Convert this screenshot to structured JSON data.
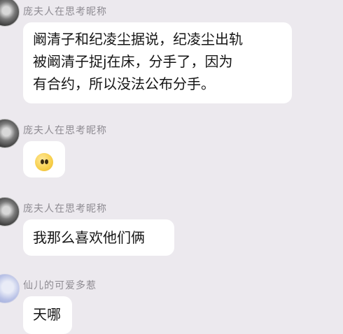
{
  "messages": [
    {
      "sender": "庞夫人在思考昵称",
      "avatar": "gray-avatar",
      "lines": [
        "阚清子和纪凌尘据说，纪凌尘出轨",
        "被阚清子捉j在床，分手了，因为",
        "有合约，所以没法公布分手。"
      ]
    },
    {
      "sender": "庞夫人在思考昵称",
      "avatar": "gray-avatar",
      "emoji": "yellow-face-emoji"
    },
    {
      "sender": "庞夫人在思考昵称",
      "avatar": "gray-avatar",
      "lines": [
        "我那么喜欢他们俩"
      ]
    },
    {
      "sender": "仙儿的可爱多惹",
      "avatar": "blue-avatar",
      "lines": [
        "天哪"
      ]
    }
  ],
  "colors": {
    "background": "#ece9ee",
    "bubble": "#ffffff",
    "sender_text": "#8e8b92",
    "message_text": "#151515"
  }
}
